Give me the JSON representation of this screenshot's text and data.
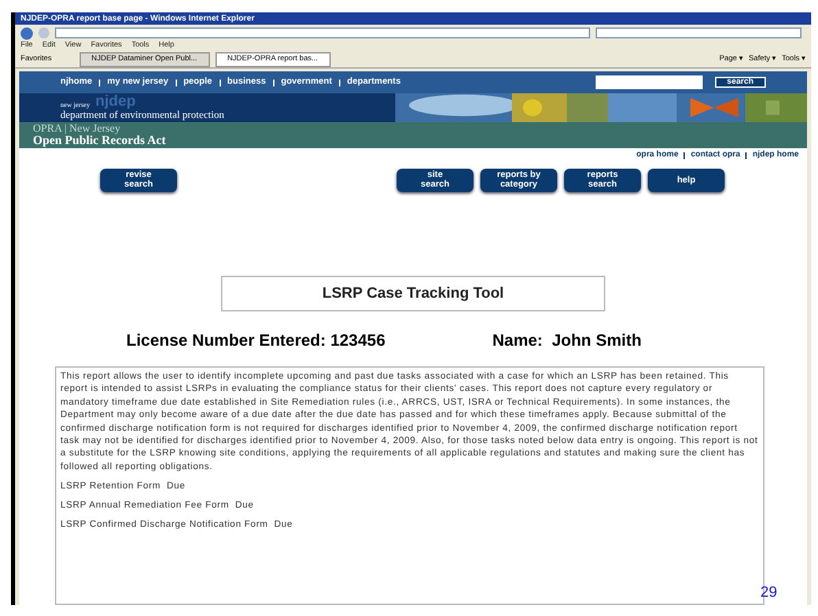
{
  "window": {
    "title": "NJDEP-OPRA report base page - Windows Internet Explorer"
  },
  "menu": [
    "File",
    "Edit",
    "View",
    "Favorites",
    "Tools",
    "Help"
  ],
  "favorites": "Favorites",
  "tabs": [
    {
      "label": "NJDEP Dataminer Open Publ...",
      "selected": false
    },
    {
      "label": "NJDEP-OPRA report bas...",
      "selected": true
    }
  ],
  "command_bar": [
    "Page ▾",
    "Safety ▾",
    "Tools ▾"
  ],
  "top_nav": [
    "njhome",
    "my new jersey",
    "people",
    "business",
    "government",
    "departments"
  ],
  "search_button": "search",
  "banner": {
    "brand_small": "new jersey",
    "brand": "njdep",
    "dept": "department of environmental protection"
  },
  "opra": {
    "line1": "OPRA | New Jersey",
    "line2": "Open Public Records Act"
  },
  "links": [
    "opra home",
    "contact opra",
    "njdep home"
  ],
  "left_buttons": [
    [
      "revise",
      "search"
    ]
  ],
  "right_buttons": [
    [
      "site",
      "search"
    ],
    [
      "reports by",
      "category"
    ],
    [
      "reports",
      "search"
    ],
    [
      "help"
    ]
  ],
  "tool_title": "LSRP Case Tracking Tool",
  "license": "License Number Entered: 123456",
  "name": "Name:  John Smith",
  "report_text": "This report allows the user to identify incomplete upcoming and past due tasks associated with a case for which an LSRP has been retained.  This report is intended to assist LSRPs in evaluating the compliance status for their clients' cases.  This report does not capture every regulatory or mandatory timeframe due date established in Site Remediation rules (i.e., ARRCS, UST, ISRA or Technical Requirements).  In some instances, the Department may only become aware of a due date after the due date has passed and for which these timeframes apply. Because submittal of the confirmed discharge notification form is not required for discharges identified prior to November 4, 2009, the confirmed discharge notification report task may not be identified for discharges identified prior to November 4, 2009. Also, for those tasks noted below data entry is ongoing.  This report is not a substitute for the LSRP knowing site conditions, applying the requirements of all applicable regulations and statutes and making sure the client has followed all reporting obligations.",
  "report_items": [
    "LSRP Retention Form  Due",
    "LSRP Annual Remediation Fee Form  Due",
    "LSRP Confirmed Discharge Notification Form  Due"
  ],
  "slide_number": "29"
}
